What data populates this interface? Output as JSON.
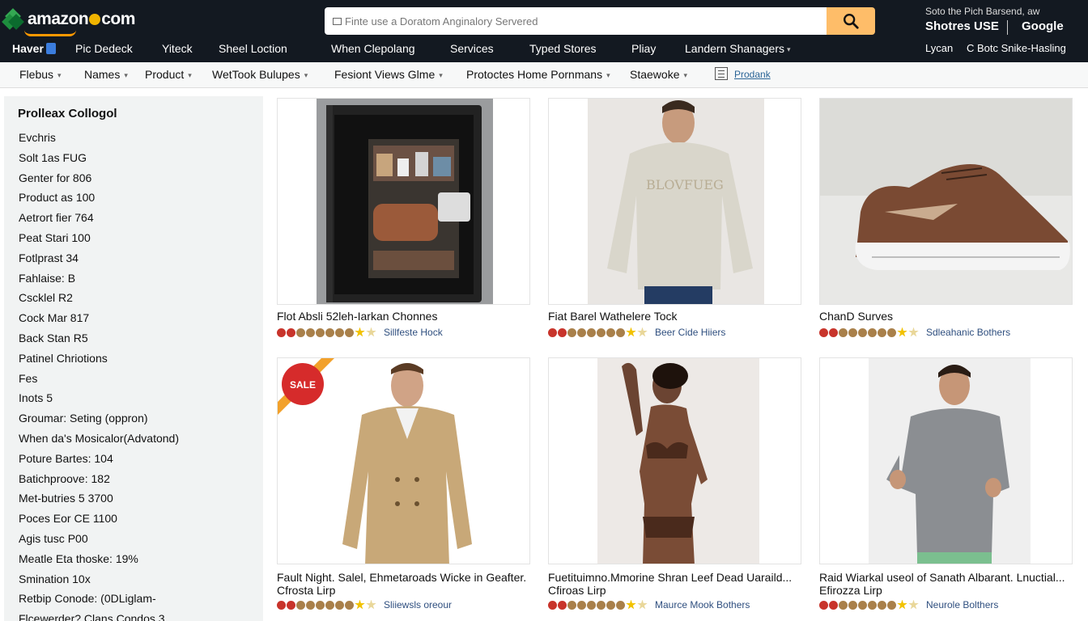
{
  "header": {
    "logo_text": "amazon",
    "logo_suffix": "com",
    "search_placeholder": "Finte use a Doratom Anginalory Servered",
    "right_small": "Soto the Pich Barsend, aw",
    "right_bold_1": "Shotres USE",
    "right_bold_2": "Google",
    "nav_left": [
      "Haver",
      "Pic Dedeck",
      "Yiteck",
      "Sheel Loction"
    ],
    "nav_center": [
      "When Clepolang",
      "Services",
      "Typed Stores",
      "Pliay",
      "Landern Shanagers"
    ],
    "nav_right_1": "Lycan",
    "nav_right_2": "C Botc Snike-Hasling"
  },
  "subnav": {
    "items": [
      "Flebus",
      "Names",
      "Product",
      "WetTook Bulupes",
      "Fesiont Views Glme",
      "Protoctes Home Pornmans",
      "Staewoke"
    ],
    "link": "Prodank"
  },
  "sidebar": {
    "title": "Prolleax Collogol",
    "items": [
      "Evchris",
      "Solt 1as FUG",
      "Genter for 806",
      "Product as 100",
      "Aetrort fier 764",
      "Peat Stari 100",
      "Fotlprast 34",
      "Fahlaise: B",
      "Cscklel R2",
      "Cock Mar 817",
      "Back Stan R5",
      "Patinel Chriotions",
      "Fes",
      "Inots 5",
      "Groumar: Seting (oppron)",
      "When da's Mosicalor(Advatond)",
      "Poture Bartes: 104",
      "Batichproove: 182",
      "Met-butries 5 3700",
      "Poces Eor CE 1100",
      "Agis tusc P00",
      "Meatle Eta thoske: 19%",
      "Smination 10x",
      "Retbip Conode: (0DLiglam-",
      "Flcewerder? Clans Condos 3"
    ]
  },
  "products": [
    {
      "title_1": "Flot Absli 52leh-Iarkan Chonnes",
      "title_2": "",
      "rating_text": "Sillfeste Hock",
      "image": "black-refrigerator-display-case"
    },
    {
      "title_1": "Fiat Barel Wathelere Tock",
      "title_2": "",
      "rating_text": "Beer Cide Hiiers",
      "image": "man-in-grey-sweatshirt"
    },
    {
      "title_1": "ChanD Surves",
      "title_2": "",
      "rating_text": "Sdleahanic Bothers",
      "image": "brown-sneaker"
    },
    {
      "title_1": "Fault Night. Salel, Ehmetaroads Wicke in Geafter.",
      "title_2": "Cfrosta Lirp",
      "rating_text": "Sliiewsls oreour",
      "image": "man-in-camel-coat",
      "badge": "SALE"
    },
    {
      "title_1": "Fuetituimno.Mmorine Shran Leef Dead Uaraild...",
      "title_2": "Cfiroas Lirp",
      "rating_text": "Maurce Mook Bothers",
      "image": "model-in-brown-swimwear"
    },
    {
      "title_1": "Raid Wiarkal useol of Sanath Albarant. Lnuctial...",
      "title_2": "Efirozza Lirp",
      "rating_text": "Neurole Bolthers",
      "image": "man-in-grey-longsleeve"
    }
  ],
  "colors": {
    "header_bg": "#131921",
    "search_button": "#febd69",
    "subnav_bg": "#f7f8f8",
    "sidebar_bg": "#f1f3f3",
    "link": "#2f4f7f"
  }
}
